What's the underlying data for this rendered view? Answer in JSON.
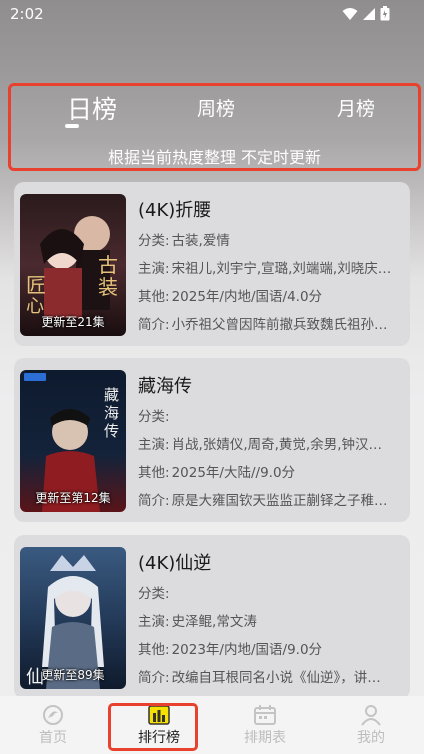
{
  "status_bar": {
    "time": "2:02"
  },
  "tabs": {
    "items": [
      {
        "label": "日榜",
        "active": true
      },
      {
        "label": "周榜",
        "active": false
      },
      {
        "label": "月榜",
        "active": false
      }
    ],
    "subtitle": "根据当前热度整理 不定时更新"
  },
  "labels": {
    "genre": "分类:",
    "cast": "主演:",
    "other": "其他:",
    "summary": "简介:"
  },
  "items": [
    {
      "title": "(4K)折腰",
      "genre": "古装,爱情",
      "cast": "宋祖儿,刘宇宁,宣璐,刘端端,刘晓庆…",
      "other": "2025年/内地/国语/4.0分",
      "summary": "小乔祖父曾因阵前撤兵致魏氏祖孙…",
      "badge": "更新至21集"
    },
    {
      "title": "藏海传",
      "genre": "",
      "cast": "肖战,张婧仪,周奇,黄觉,余男,钟汉…",
      "other": "2025年/大陆//9.0分",
      "summary": "原是大雍国钦天监监正蒯铎之子稚…",
      "badge": "更新至第12集"
    },
    {
      "title": "(4K)仙逆",
      "genre": "",
      "cast": "史泽鲲,常文涛",
      "other": "2023年/内地/国语/9.0分",
      "summary": "改编自耳根同名小说《仙逆》，讲…",
      "badge": "更新至89集"
    }
  ],
  "bottom_nav": {
    "home": "首页",
    "rank": "排行榜",
    "schedule": "排期表",
    "mine": "我的"
  },
  "colors": {
    "highlight_border": "#e8422f",
    "rank_icon": "#f5e000"
  }
}
